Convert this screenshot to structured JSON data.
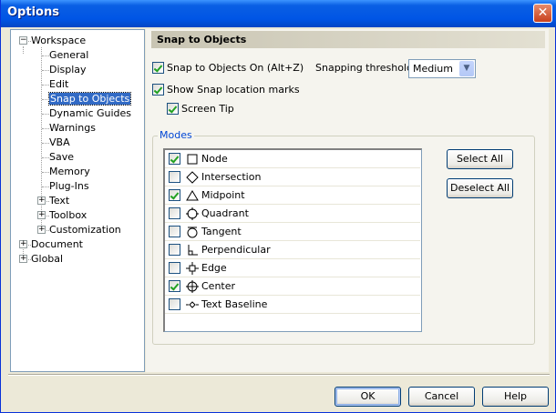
{
  "window": {
    "title": "Options",
    "close_icon": "close-icon"
  },
  "tree": {
    "items": [
      {
        "label": "Workspace",
        "expander": "−"
      },
      {
        "label": "General"
      },
      {
        "label": "Display"
      },
      {
        "label": "Edit"
      },
      {
        "label": "Snap to Objects",
        "selected": true
      },
      {
        "label": "Dynamic Guides"
      },
      {
        "label": "Warnings"
      },
      {
        "label": "VBA"
      },
      {
        "label": "Save"
      },
      {
        "label": "Memory"
      },
      {
        "label": "Plug-Ins"
      },
      {
        "label": "Text",
        "expander": "+"
      },
      {
        "label": "Toolbox",
        "expander": "+"
      },
      {
        "label": "Customization",
        "expander": "+"
      },
      {
        "label": "Document",
        "expander": "+"
      },
      {
        "label": "Global",
        "expander": "+"
      }
    ]
  },
  "panel": {
    "title": "Snap to Objects",
    "snap_on": {
      "label": "Snap to Objects On (Alt+Z)",
      "checked": true
    },
    "threshold": {
      "label": "Snapping threshold",
      "value": "Medium"
    },
    "show_marks": {
      "label": "Show Snap location marks",
      "checked": true
    },
    "screen_tip": {
      "label": "Screen Tip",
      "checked": true
    },
    "modes": {
      "label": "Modes",
      "items": [
        {
          "label": "Node",
          "checked": true,
          "icon": "square"
        },
        {
          "label": "Intersection",
          "checked": false,
          "icon": "diamond"
        },
        {
          "label": "Midpoint",
          "checked": true,
          "icon": "triangle"
        },
        {
          "label": "Quadrant",
          "checked": false,
          "icon": "quadrant"
        },
        {
          "label": "Tangent",
          "checked": false,
          "icon": "tangent"
        },
        {
          "label": "Perpendicular",
          "checked": false,
          "icon": "perpendicular"
        },
        {
          "label": "Edge",
          "checked": false,
          "icon": "edge"
        },
        {
          "label": "Center",
          "checked": true,
          "icon": "center"
        },
        {
          "label": "Text Baseline",
          "checked": false,
          "icon": "baseline"
        }
      ]
    },
    "select_all": "Select All",
    "deselect_all": "Deselect All"
  },
  "footer": {
    "ok": "OK",
    "cancel": "Cancel",
    "help": "Help"
  }
}
